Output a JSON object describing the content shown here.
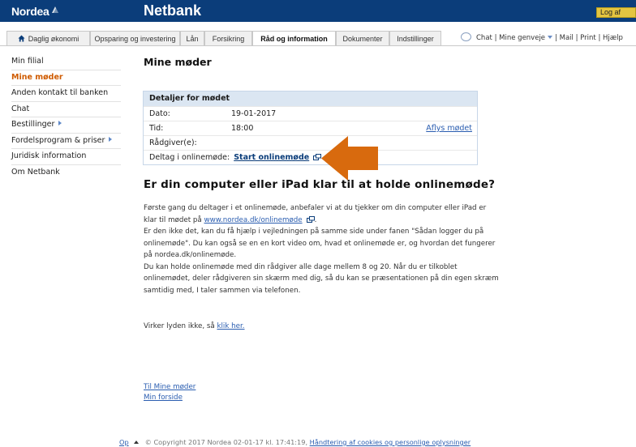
{
  "header": {
    "logo_text": "Nordea",
    "app_title": "Netbank",
    "logout_label": "Log af"
  },
  "nav": {
    "tabs": [
      {
        "label": "Daglig økonomi",
        "icon": "home-icon"
      },
      {
        "label": "Opsparing og investering"
      },
      {
        "label": "Lån"
      },
      {
        "label": "Forsikring"
      },
      {
        "label": "Råd og information",
        "active": true
      },
      {
        "label": "Dokumenter"
      },
      {
        "label": "Indstillinger"
      }
    ],
    "utils": {
      "chat": "Chat",
      "shortcuts": "Mine genveje",
      "mail": "Mail",
      "print": "Print",
      "help": "Hjælp",
      "separator": "|"
    }
  },
  "sidebar": {
    "items": [
      {
        "label": "Min filial"
      },
      {
        "label": "Mine møder",
        "active": true
      },
      {
        "label": "Anden kontakt til banken"
      },
      {
        "label": "Chat"
      },
      {
        "label": "Bestillinger",
        "submenu": true
      },
      {
        "label": "Fordelsprogram & priser",
        "submenu": true
      },
      {
        "label": "Juridisk information"
      },
      {
        "label": "Om Netbank"
      }
    ]
  },
  "main": {
    "title": "Mine møder",
    "details": {
      "header": "Detaljer for mødet",
      "date_label": "Dato:",
      "date_value": "19-01-2017",
      "time_label": "Tid:",
      "time_value": "18:00",
      "cancel_link": "Aflys mødet",
      "advisor_label": "Rådgiver(e):",
      "online_label": "Deltag i onlinemøde:",
      "online_link": "Start onlinemøde"
    },
    "heading": "Er din computer eller iPad klar til at holde onlinemøde?",
    "p1_pre": "Første gang du deltager i et onlinemøde, anbefaler vi at du tjekker om din computer eller iPad er klar til mødet på ",
    "p1_link": "www.nordea.dk/onlinemøde",
    "p1_post": ".",
    "p2": "Er den ikke det, kan du få hjælp i vejledningen på samme side under fanen \"Sådan logger du på onlinemøde\". Du kan også se en en kort video om, hvad et onlinemøde er, og hvordan det fungerer på nordea.dk/onlinemøde.",
    "p3": "Du kan holde onlinemøde med din rådgiver alle dage mellem 8 og 20. Når du er tilkoblet onlinemødet, deler rådgiveren sin skærm med dig, så du kan se præsentationen på din egen skræm samtidig med, I taler sammen via telefonen.",
    "sound_text": "Virker lyden ikke, så ",
    "sound_link": "klik her.",
    "link_my_meetings": "Til Mine møder",
    "link_front": "Min forside"
  },
  "footer": {
    "up_label": "Op",
    "copyright": "© Copyright 2017 Nordea 02-01-17 kl. 17:41:19, ",
    "cookies_link": "Håndtering af cookies og personlige oplysninger"
  },
  "colors": {
    "brand_blue": "#0b3d7a",
    "active_orange": "#cf5b00",
    "arrow_orange": "#d86a0e",
    "logout_yellow": "#e3c541",
    "link_blue": "#2a5db0"
  }
}
